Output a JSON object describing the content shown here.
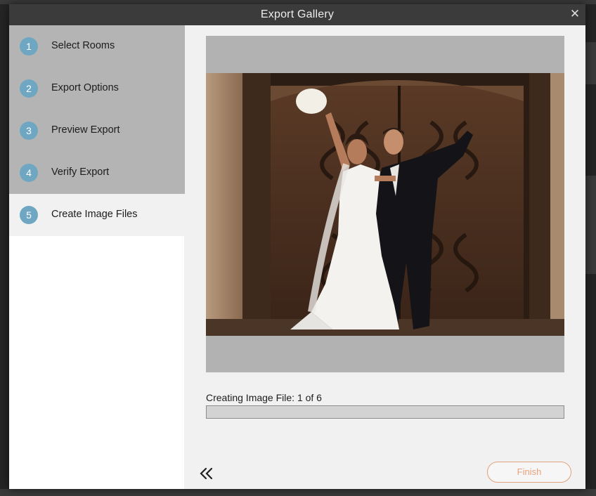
{
  "dialog": {
    "title": "Export Gallery",
    "close_icon": "close-icon",
    "close_glyph": "✕"
  },
  "steps": [
    {
      "number": "1",
      "label": "Select Rooms",
      "active": false
    },
    {
      "number": "2",
      "label": "Export Options",
      "active": false
    },
    {
      "number": "3",
      "label": "Preview Export",
      "active": false
    },
    {
      "number": "4",
      "label": "Verify Export",
      "active": false
    },
    {
      "number": "5",
      "label": "Create Image Files",
      "active": true
    }
  ],
  "progress": {
    "label": "Creating Image File: 1 of 6",
    "fraction": 0
  },
  "footer": {
    "back_icon": "double-chevron-left-icon",
    "finish_label": "Finish"
  },
  "colors": {
    "step_badge": "#6fa7c3",
    "finish_accent": "#e9a37c",
    "titlebar": "#3b3b3b"
  }
}
